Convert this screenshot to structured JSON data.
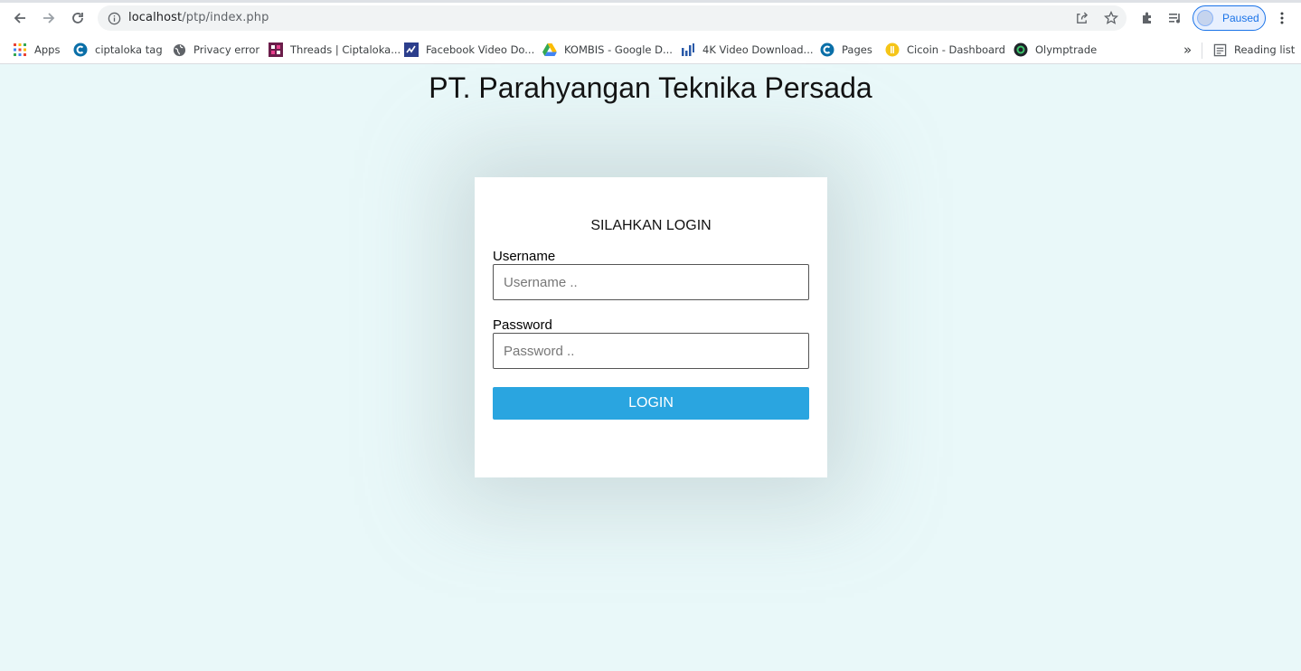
{
  "browser": {
    "url_host": "localhost",
    "url_path": "/ptp/index.php",
    "profile_label": "Paused"
  },
  "bookmarks": {
    "items": [
      {
        "label": "Apps",
        "icon": "apps-grid-icon"
      },
      {
        "label": "ciptaloka tag",
        "icon": "ciptaloka-icon"
      },
      {
        "label": "Privacy error",
        "icon": "globe-icon"
      },
      {
        "label": "Threads | Ciptaloka...",
        "icon": "threads-icon"
      },
      {
        "label": "Facebook Video Do...",
        "icon": "fbdownloader-icon"
      },
      {
        "label": "KOMBIS - Google D...",
        "icon": "google-drive-icon"
      },
      {
        "label": "4K Video Download...",
        "icon": "4k-downloader-icon"
      },
      {
        "label": "Pages",
        "icon": "pages-icon"
      },
      {
        "label": "Cicoin - Dashboard",
        "icon": "cicoin-icon"
      },
      {
        "label": "Olymptrade",
        "icon": "olymptrade-icon"
      }
    ],
    "overflow": "»",
    "reading_list": "Reading list"
  },
  "page": {
    "title": "PT. Parahyangan Teknika Persada"
  },
  "login": {
    "heading": "SILAHKAN LOGIN",
    "username_label": "Username",
    "username_placeholder": "Username ..",
    "password_label": "Password",
    "password_placeholder": "Password ..",
    "submit_label": "LOGIN"
  },
  "colors": {
    "page_bg": "#e9f8f9",
    "button_bg": "#2aa5e0",
    "card_bg": "#ffffff"
  }
}
